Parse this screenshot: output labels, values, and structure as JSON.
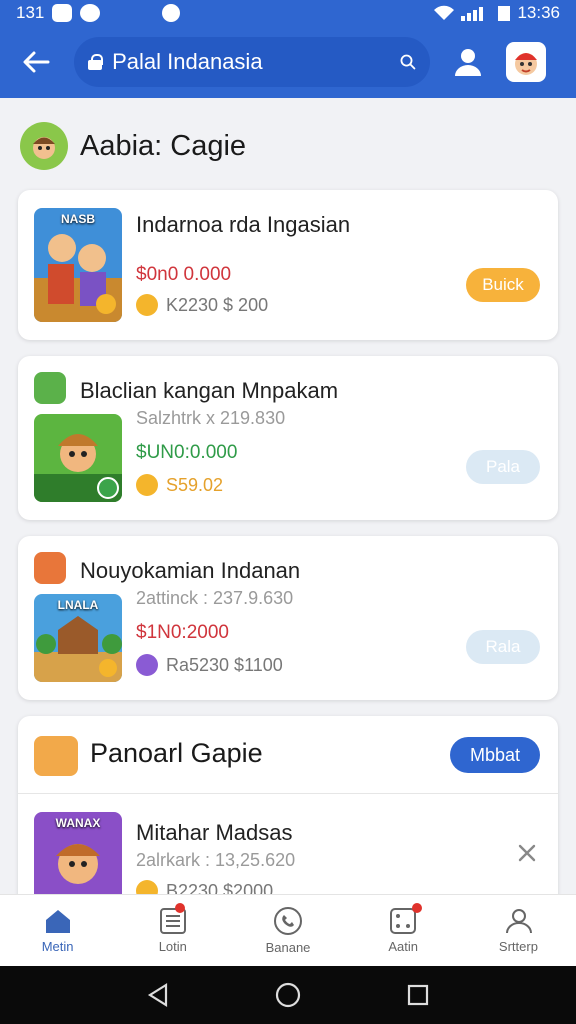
{
  "status": {
    "left": "131",
    "time": "13:36"
  },
  "appbar": {
    "search_value": "Palal Indanasia"
  },
  "section": {
    "title": "Aabia: Cagie"
  },
  "items": [
    {
      "thumb_label": "NASB",
      "name": "Indarnoa rda Ingasian",
      "price": "$0n0 0.000",
      "coins": "K2230  $ 200",
      "button": "Buick",
      "price_color": "#d0353c",
      "button_color": "#f7b23b"
    },
    {
      "name": "Blaclian kangan Mnpakam",
      "sub": "Salzhtrk x 219.830",
      "price": "$UN0:0.000",
      "coins": "S59.02",
      "button": "Pala",
      "price_color": "#2f9b48",
      "button_color": "#dbe9f4"
    },
    {
      "thumb_label": "LNALA",
      "name": "Nouyokamian Indanan",
      "sub": "2attinck : 237.9.630",
      "price": "$1N0:2000",
      "coins": "Ra5230  $1100",
      "button": "Rala",
      "price_color": "#d0353c",
      "button_color": "#dbe9f4"
    }
  ],
  "card4": {
    "title": "Panoarl Gapie",
    "more": "Mbbat",
    "item": {
      "thumb_label": "WANAX",
      "name": "Mitahar Madsas",
      "sub": "2alrkark : 13,25.620",
      "coins": "B2230  $2000"
    }
  },
  "bottomnav": [
    {
      "label": "Metin",
      "icon": "home-icon"
    },
    {
      "label": "Lotin",
      "icon": "list-icon"
    },
    {
      "label": "Banane",
      "icon": "phone-icon"
    },
    {
      "label": "Aatin",
      "icon": "dice-icon"
    },
    {
      "label": "Srtterp",
      "icon": "user-settings-icon"
    }
  ],
  "colors": {
    "primary": "#2f66d0",
    "accent": "#f7b23b"
  }
}
